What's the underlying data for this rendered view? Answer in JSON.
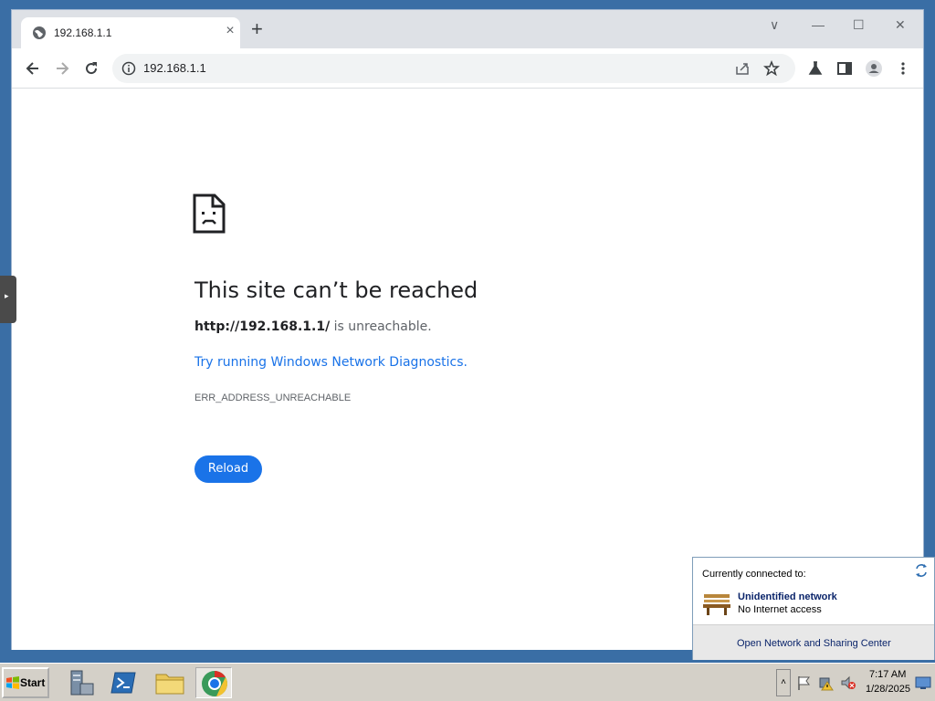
{
  "browser": {
    "tab": {
      "title": "192.168.1.1",
      "close_glyph": "×",
      "favicon": "globe-icon"
    },
    "new_tab_glyph": "+",
    "window_controls": {
      "chevron": "∨",
      "minimize": "—",
      "maximize": "☐",
      "close": "✕"
    },
    "toolbar": {
      "url": "192.168.1.1",
      "icons": [
        "back-icon",
        "forward-icon",
        "reload-icon",
        "info-icon",
        "share-icon",
        "star-icon",
        "labs-icon",
        "side-panel-icon",
        "profile-icon",
        "menu-icon"
      ]
    }
  },
  "error_page": {
    "title": "This site can’t be reached",
    "desc_url": "http://192.168.1.1/",
    "desc_rest": " is unreachable.",
    "link": "Try running Windows Network Diagnostics.",
    "code": "ERR_ADDRESS_UNREACHABLE",
    "reload_label": "Reload"
  },
  "side_handle": {
    "glyph": "▸"
  },
  "network_popup": {
    "header": "Currently connected to:",
    "network_name": "Unidentified network",
    "network_status": "No Internet access",
    "link": "Open Network and Sharing Center"
  },
  "taskbar": {
    "start_label": "Start",
    "apps": [
      "server-manager-icon",
      "powershell-icon",
      "file-explorer-icon",
      "chrome-icon"
    ],
    "tray": {
      "up_glyph": "˄",
      "time": "7:17 AM",
      "date": "1/28/2025"
    }
  },
  "colors": {
    "desktop": "#3a6ea5",
    "accent": "#1a73e8",
    "tab_strip": "#dee1e6",
    "taskbar": "#d4d0c8"
  }
}
